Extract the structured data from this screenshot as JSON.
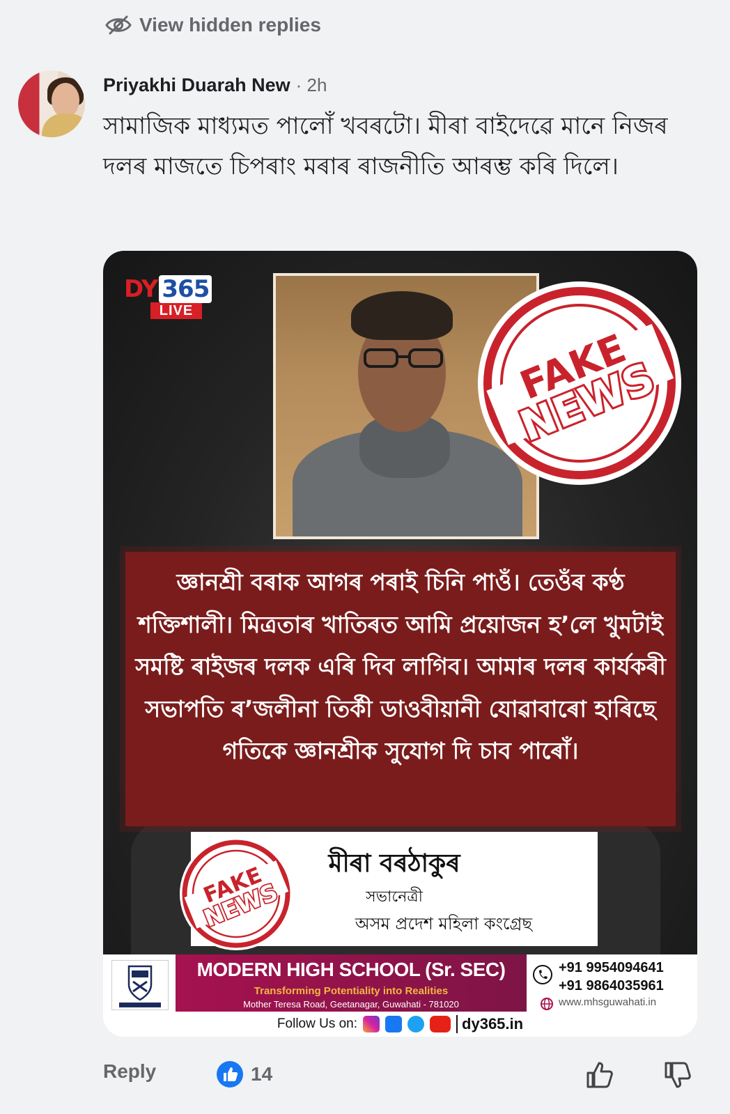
{
  "hidden_replies": {
    "label": "View hidden replies",
    "icon": "eye-slash-icon"
  },
  "comment": {
    "author": "Priyakhi Duarah New",
    "time": "· 2h",
    "text": "সামাজিক মাধ্যমত পালোঁ খবৰটো। মীৰা বাইদেৱে মানে নিজৰ দলৰ মাজতে চিপৰাং মৰাৰ ৰাজনীতি আৰম্ভ কৰি দিলে।"
  },
  "post": {
    "channel_logo": {
      "name": "DY",
      "number": "365",
      "live": "LIVE"
    },
    "stamp": {
      "line1": "FAKE",
      "line2": "NEWS",
      "color": "#c8232c"
    },
    "quote": "জ্ঞানশ্ৰী বৰাক আগৰ পৰাই চিনি পাওঁ। তেওঁৰ কণ্ঠ শক্তিশালী। মিত্ৰতাৰ খাতিৰত আমি প্ৰয়োজন হ’লে খুমটাই সমষ্টি ৰাইজৰ দলক এৰি দিব লাগিব। আমাৰ দলৰ কাৰ্যকৰী সভাপতি ৰ’জলীনা তিৰ্কী ডাওবীয়ানী যোৱাবাৰো হাৰিছে গতিকে জ্ঞানশ্ৰীক সুযোগ দি চাব পাৰোঁ।",
    "signature": {
      "name": "মীৰা বৰঠাকুৰ",
      "title": "সভানেত্ৰী",
      "org": "অসম প্ৰদেশ মহিলা কংগ্ৰেছ"
    },
    "ad": {
      "school": "MODERN HIGH SCHOOL (Sr. SEC)",
      "tagline": "Transforming Potentiality into Realities",
      "address": "Mother Teresa Road, Geetanagar, Guwahati - 781020",
      "phone1": "+91 9954094641",
      "phone2": "+91 9864035961",
      "website": "www.mhsguwahati.in"
    },
    "follow": {
      "label": "Follow Us on:",
      "domain": "dy365.in"
    }
  },
  "actions": {
    "reply": "Reply",
    "reaction_count": "14",
    "like_icon": "thumbs-up-icon",
    "dislike_icon": "thumbs-down-icon"
  },
  "colors": {
    "accent_blue": "#1877f2",
    "muted_text": "#65676b",
    "banner_red": "#7b1c1c"
  }
}
